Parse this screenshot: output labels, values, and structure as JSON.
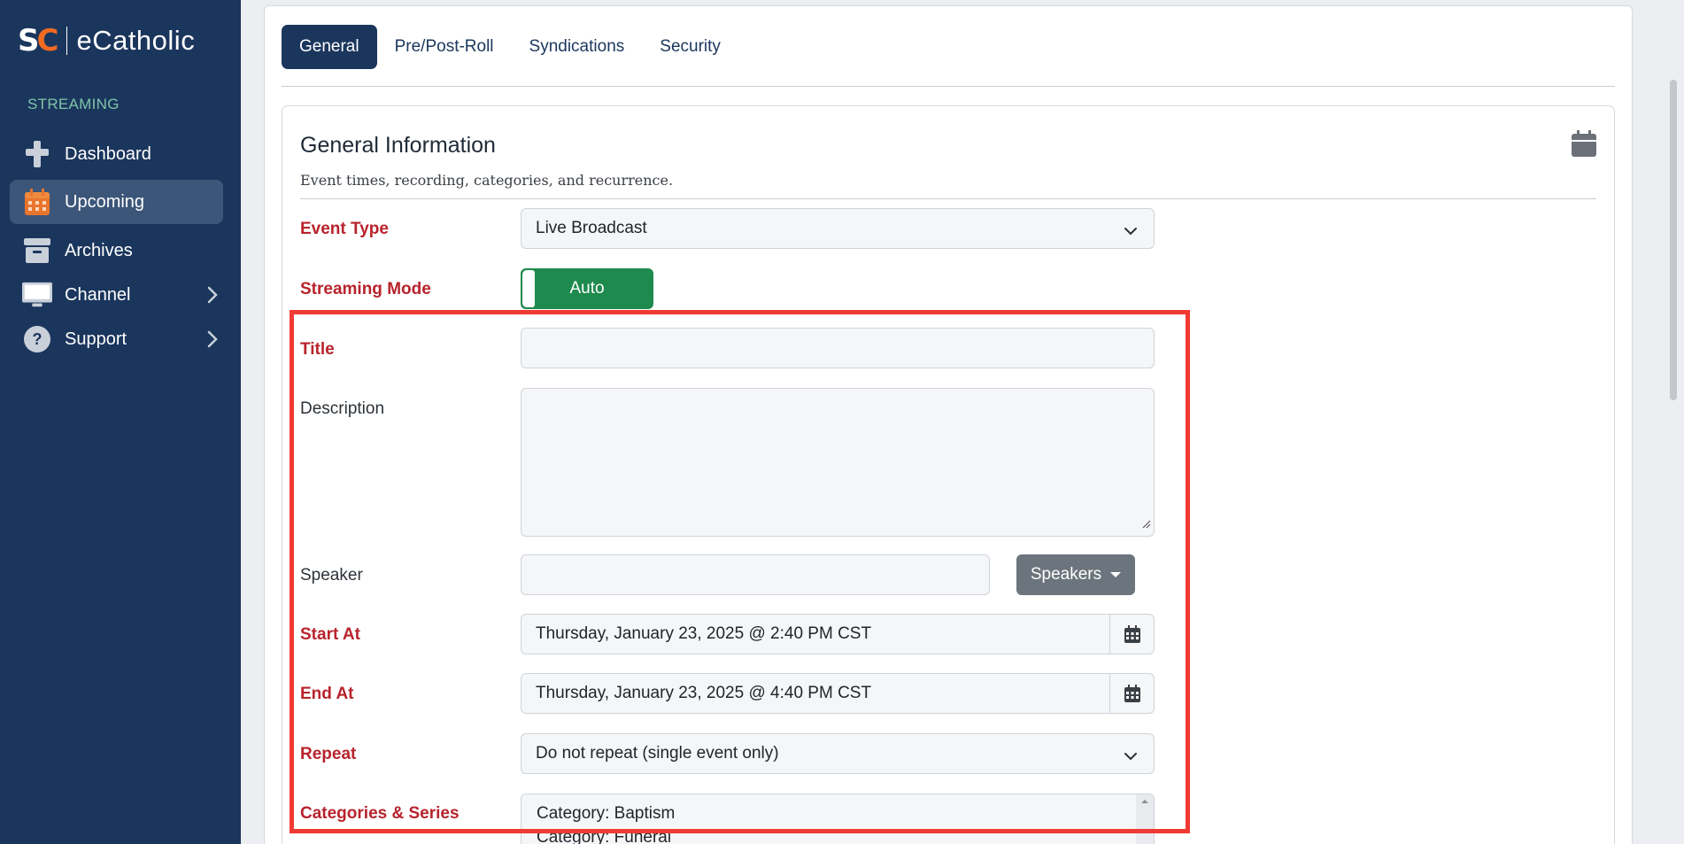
{
  "brand": {
    "logo_text": "SC",
    "name": "eCatholic"
  },
  "sidebar": {
    "heading": "STREAMING",
    "items": [
      {
        "label": "Dashboard",
        "icon": "plus-icon",
        "active": false
      },
      {
        "label": "Upcoming",
        "icon": "calendar-icon",
        "active": true
      },
      {
        "label": "Archives",
        "icon": "archive-box-icon",
        "active": false
      },
      {
        "label": "Channel",
        "icon": "monitor-icon",
        "active": false,
        "expandable": true
      },
      {
        "label": "Support",
        "icon": "question-icon",
        "active": false,
        "expandable": true
      }
    ]
  },
  "tabs": [
    {
      "label": "General",
      "active": true
    },
    {
      "label": "Pre/Post-Roll",
      "active": false
    },
    {
      "label": "Syndications",
      "active": false
    },
    {
      "label": "Security",
      "active": false
    }
  ],
  "section": {
    "title": "General Information",
    "subtitle": "Event times, recording, categories, and recurrence."
  },
  "form": {
    "event_type": {
      "label": "Event Type",
      "value": "Live Broadcast"
    },
    "streaming_mode": {
      "label": "Streaming Mode",
      "value": "Auto"
    },
    "title": {
      "label": "Title",
      "value": ""
    },
    "description": {
      "label": "Description",
      "value": ""
    },
    "speaker": {
      "label": "Speaker",
      "value": "",
      "button": "Speakers"
    },
    "start_at": {
      "label": "Start At",
      "value": "Thursday, January 23, 2025 @ 2:40 PM CST"
    },
    "end_at": {
      "label": "End At",
      "value": "Thursday, January 23, 2025 @ 4:40 PM CST"
    },
    "repeat": {
      "label": "Repeat",
      "value": "Do not repeat (single event only)"
    },
    "categories": {
      "label": "Categories & Series",
      "options": [
        "Category: Baptism",
        "Category: Funeral"
      ]
    }
  },
  "colors": {
    "sidebar": "#1b365d",
    "accent_orange": "#f26b21",
    "required_label": "#b8232c",
    "toggle_green": "#1e8a4d",
    "highlight": "#f03a34"
  }
}
